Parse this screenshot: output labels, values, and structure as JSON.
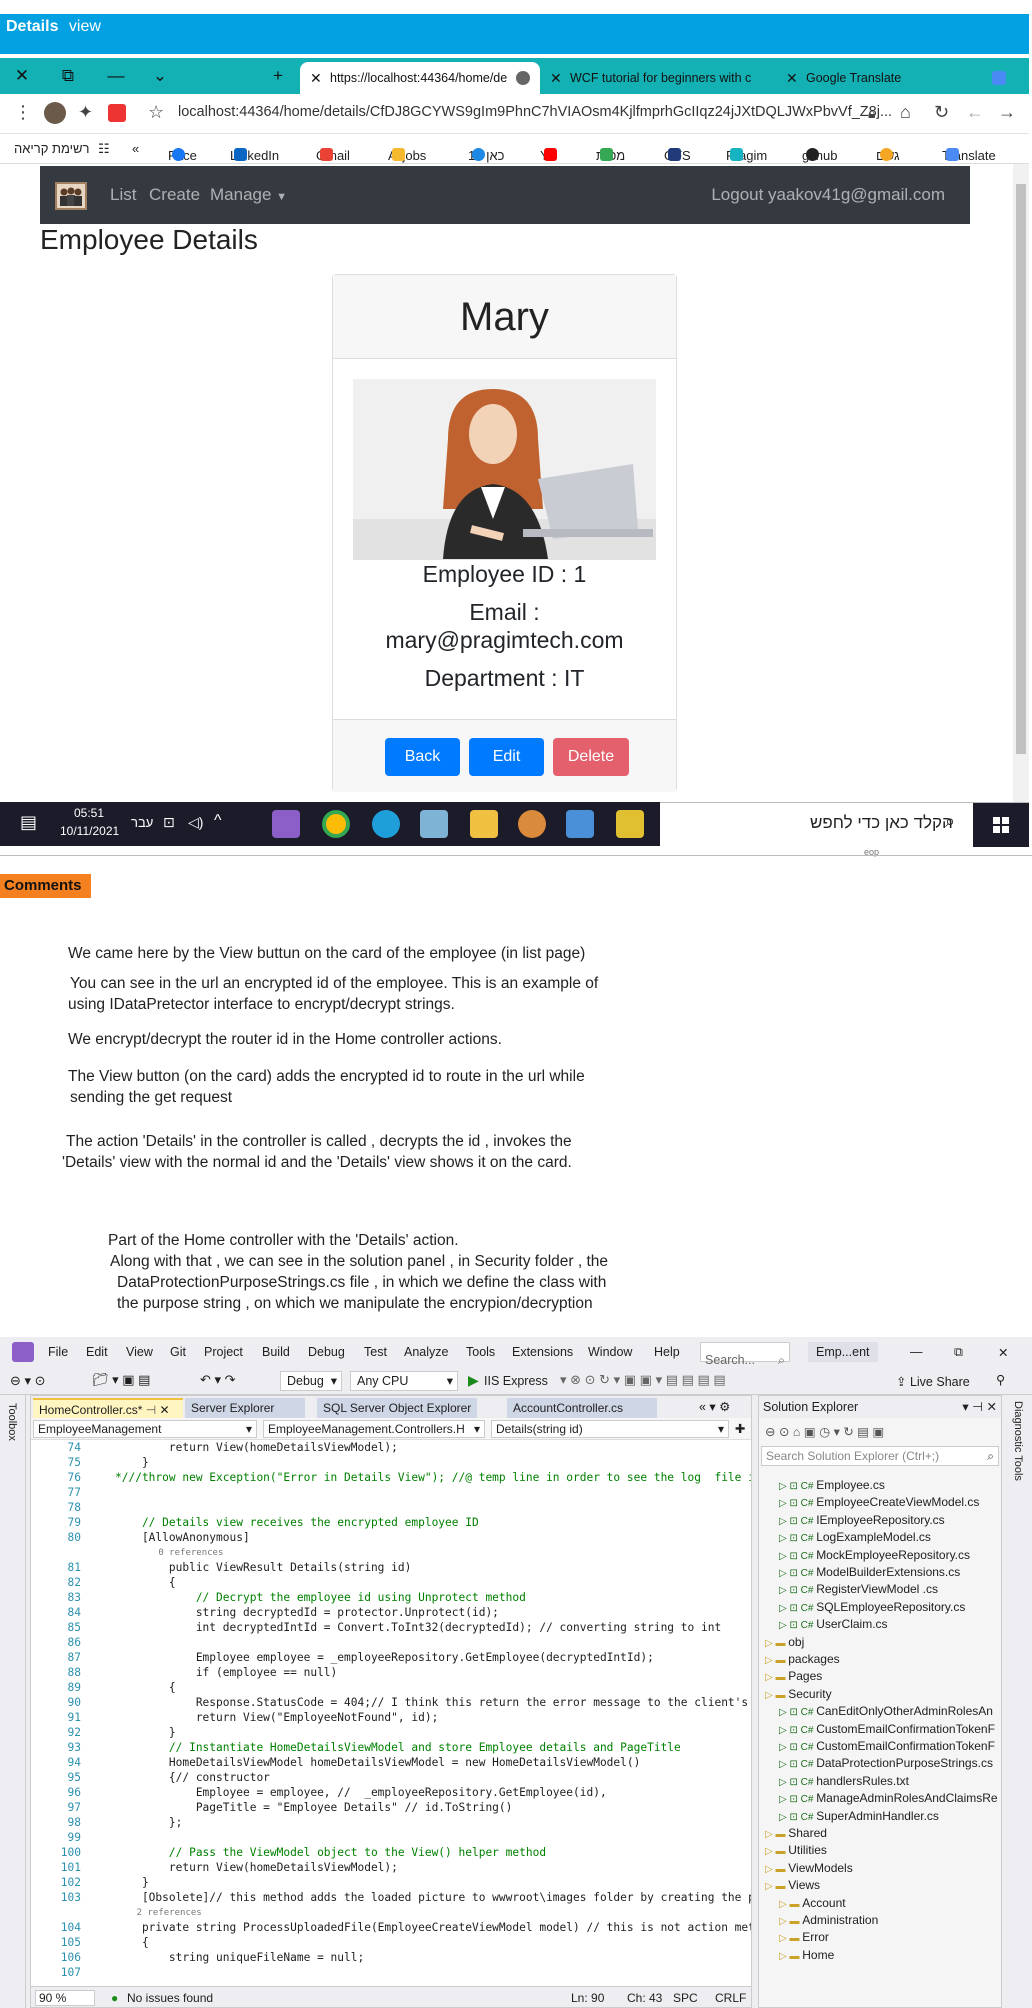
{
  "window": {
    "title_bold": "Details",
    "title_rest": "view"
  },
  "browser": {
    "window_controls": [
      "✕",
      "⧉",
      "—",
      "⌄",
      "+"
    ],
    "tabs": [
      {
        "label": "https://localhost:44364/home/de",
        "active": true
      },
      {
        "label": "WCF tutorial for beginners with c",
        "active": false
      },
      {
        "label": "Google Translate",
        "active": false
      }
    ],
    "url": "localhost:44364/home/details/CfDJ8GCYWS9gIm9PhnC7hVIAOsm4KjlfmprhGcIIqz24jJXtDQLJWxPbvVf_Z8j...",
    "bookmarks": [
      "רשימת קריאה",
      "Face",
      "LinkedIn",
      "Gmail",
      "Alljobs",
      "כאן 11",
      "YT",
      "מפות",
      "GFS",
      "Pragim",
      "github",
      "גשם",
      "Translate"
    ]
  },
  "site": {
    "nav": {
      "list": "List",
      "create": "Create",
      "manage": "Manage",
      "logout": "Logout yaakov41g@gmail.com"
    },
    "heading": "Employee Details",
    "employee": {
      "name": "Mary",
      "id_line": "Employee ID : 1",
      "email_label": "Email :",
      "email": "mary@pragimtech.com",
      "department_line": "Department : IT"
    },
    "buttons": {
      "back": "Back",
      "edit": "Edit",
      "delete": "Delete"
    },
    "colors": {
      "primary": "#007bff",
      "danger": "#e4606d",
      "navbar": "#343a40"
    }
  },
  "taskbar": {
    "time": "05:51",
    "date": "10/11/2021",
    "lang": "עבר",
    "search": "הקלד כאן כדי לחפש",
    "tiny": "eop"
  },
  "comments": {
    "label": "Comments",
    "lines": [
      "We came here by the View buttun on the card of the employee (in list page)",
      "You can see in the url an  encrypted  id of the employee.  This is an example of",
      "using IDataPretector interface to  encrypt/decrypt  strings.",
      "We  encrypt/decrypt  the  router  id in the  Home controller actions.",
      "The View button  (on the card) adds the encrypted id to route in the url while",
      "sending the get request",
      "The action 'Details' in the controller is called ,  decrypts the id , invokes the",
      "'Details' view with the normal id and  the 'Details' view  shows it on the card.",
      "Part of the Home controller with the 'Details' action.",
      "Along with that ,  we can see in the solution panel , in Security folder , the",
      "DataProtectionPurposeStrings.cs file , in which we define the class with",
      "the purpose string , on which we manipulate the encrypion/decryption"
    ]
  },
  "vs": {
    "menu": [
      "File",
      "Edit",
      "View",
      "Git",
      "Project",
      "Build",
      "Debug",
      "Test",
      "Analyze",
      "Tools",
      "Extensions",
      "Window",
      "Help"
    ],
    "search": "Search...",
    "solution_short": "Emp...ent",
    "config": "Debug",
    "platform": "Any CPU",
    "run": "IIS Express",
    "live_share": "Live Share",
    "toolbox": "Toolbox",
    "diagnostic": "Diagnostic Tools",
    "editor_tabs": [
      "HomeController.cs*",
      "Server Explorer",
      "SQL Server Object Explorer",
      "AccountController.cs"
    ],
    "nav": [
      "EmployeeManagement",
      "EmployeeManagement.Controllers.H",
      "Details(string id)"
    ],
    "code": [
      {
        "n": "74",
        "t": "        return View(homeDetailsViewModel);"
      },
      {
        "n": "75",
        "t": "    }"
      },
      {
        "n": "76",
        "t": "*///throw new Exception(\"Error in Details View\"); //@ temp line in order to see the log  file i"
      },
      {
        "n": "77",
        "t": ""
      },
      {
        "n": "78",
        "t": ""
      },
      {
        "n": "79",
        "t": "    // Details view receives the encrypted employee ID"
      },
      {
        "n": "80",
        "t": "    [AllowAnonymous]"
      },
      {
        "n": "",
        "t": "        0 references"
      },
      {
        "n": "81",
        "t": "        public ViewResult Details(string id)"
      },
      {
        "n": "82",
        "t": "        {"
      },
      {
        "n": "83",
        "t": "            // Decrypt the employee id using Unprotect method"
      },
      {
        "n": "84",
        "t": "            string decryptedId = protector.Unprotect(id);"
      },
      {
        "n": "85",
        "t": "            int decryptedIntId = Convert.ToInt32(decryptedId); // converting string to int"
      },
      {
        "n": "86",
        "t": ""
      },
      {
        "n": "87",
        "t": "            Employee employee = _employeeRepository.GetEmployee(decryptedIntId);"
      },
      {
        "n": "88",
        "t": "            if (employee == null)"
      },
      {
        "n": "89",
        "t": "        {"
      },
      {
        "n": "90",
        "t": "            Response.StatusCode = 404;// I think this return the error message to the client's page"
      },
      {
        "n": "91",
        "t": "            return View(\"EmployeeNotFound\", id);"
      },
      {
        "n": "92",
        "t": "        }"
      },
      {
        "n": "93",
        "t": "        // Instantiate HomeDetailsViewModel and store Employee details and PageTitle"
      },
      {
        "n": "94",
        "t": "        HomeDetailsViewModel homeDetailsViewModel = new HomeDetailsViewModel()"
      },
      {
        "n": "95",
        "t": "        {// constructor"
      },
      {
        "n": "96",
        "t": "            Employee = employee, //  _employeeRepository.GetEmployee(id),"
      },
      {
        "n": "97",
        "t": "            PageTitle = \"Employee Details\" // id.ToString()"
      },
      {
        "n": "98",
        "t": "        };"
      },
      {
        "n": "99",
        "t": ""
      },
      {
        "n": "100",
        "t": "        // Pass the ViewModel object to the View() helper method"
      },
      {
        "n": "101",
        "t": "        return View(homeDetailsViewModel);"
      },
      {
        "n": "102",
        "t": "    }"
      },
      {
        "n": "103",
        "t": "    [Obsolete]// this method adds the loaded picture to wwwroot\\images folder by creating the path"
      },
      {
        "n": "",
        "t": "    2 references"
      },
      {
        "n": "104",
        "t": "    private string ProcessUploadedFile(EmployeeCreateViewModel model) // this is not action method,"
      },
      {
        "n": "105",
        "t": "    {"
      },
      {
        "n": "106",
        "t": "        string uniqueFileName = null;"
      },
      {
        "n": "107",
        "t": ""
      }
    ],
    "status": {
      "zoom": "90 %",
      "issues": "No issues found",
      "ln": "Ln: 90",
      "ch": "Ch: 43",
      "spc": "SPC",
      "crlf": "CRLF"
    },
    "solution_explorer": {
      "title": "Solution Explorer",
      "search": "Search Solution Explorer (Ctrl+;)",
      "items": [
        {
          "label": "Employee.cs",
          "indent": 2
        },
        {
          "label": "EmployeeCreateViewModel.cs",
          "indent": 2
        },
        {
          "label": "IEmployeeRepository.cs",
          "indent": 2
        },
        {
          "label": "LogExampleModel.cs",
          "indent": 2
        },
        {
          "label": "MockEmployeeRepository.cs",
          "indent": 2
        },
        {
          "label": "ModelBuilderExtensions.cs",
          "indent": 2
        },
        {
          "label": "RegisterViewModel .cs",
          "indent": 2
        },
        {
          "label": "SQLEmployeeRepository.cs",
          "indent": 2
        },
        {
          "label": "UserClaim.cs",
          "indent": 2
        },
        {
          "label": "obj",
          "indent": 1
        },
        {
          "label": "packages",
          "indent": 1
        },
        {
          "label": "Pages",
          "indent": 1
        },
        {
          "label": "Security",
          "indent": 1
        },
        {
          "label": "CanEditOnlyOtherAdminRolesAn",
          "indent": 2
        },
        {
          "label": "CustomEmailConfirmationTokenF",
          "indent": 2
        },
        {
          "label": "CustomEmailConfirmationTokenF",
          "indent": 2
        },
        {
          "label": "DataProtectionPurposeStrings.cs",
          "indent": 2
        },
        {
          "label": "handlersRules.txt",
          "indent": 2
        },
        {
          "label": "ManageAdminRolesAndClaimsRe",
          "indent": 2
        },
        {
          "label": "SuperAdminHandler.cs",
          "indent": 2
        },
        {
          "label": "Shared",
          "indent": 1
        },
        {
          "label": "Utilities",
          "indent": 1
        },
        {
          "label": "ViewModels",
          "indent": 1
        },
        {
          "label": "Views",
          "indent": 1
        },
        {
          "label": "Account",
          "indent": 2
        },
        {
          "label": "Administration",
          "indent": 2
        },
        {
          "label": "Error",
          "indent": 2
        },
        {
          "label": "Home",
          "indent": 2
        }
      ]
    }
  }
}
